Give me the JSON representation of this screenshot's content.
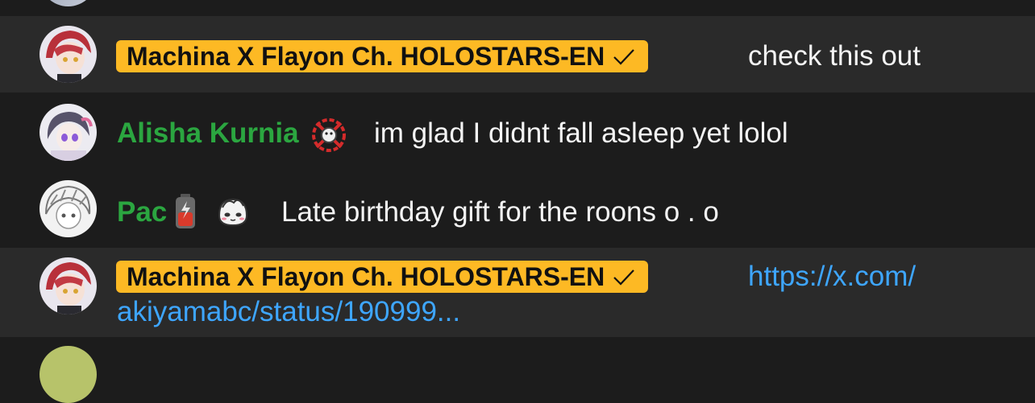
{
  "messages": [
    {
      "author": "Machina X Flayon Ch. HOLOSTARS-EN",
      "author_type": "owner",
      "verified_icon": "checkmark-icon",
      "text": "check this out"
    },
    {
      "author": "Alisha Kurnia",
      "author_type": "member",
      "badge_icon": "member-badge-icon",
      "text": "im glad I didnt fall asleep yet lolol"
    },
    {
      "author": "Pac",
      "author_type": "member",
      "badge_icon": "battery-badge-icon",
      "emote_icon": "chibi-face-emote-icon",
      "text": "Late birthday gift for the roons o . o"
    },
    {
      "author": "Machina X Flayon Ch. HOLOSTARS-EN",
      "author_type": "owner",
      "verified_icon": "checkmark-icon",
      "link_line1": "https://x.com/",
      "link_line2": "akiyamabc/status/190999..."
    }
  ],
  "colors": {
    "background": "#1c1c1c",
    "owner_row_bg": "#2a2a2a",
    "owner_badge": "#fdb924",
    "member_name": "#2ba640",
    "link": "#3ea6ff"
  }
}
